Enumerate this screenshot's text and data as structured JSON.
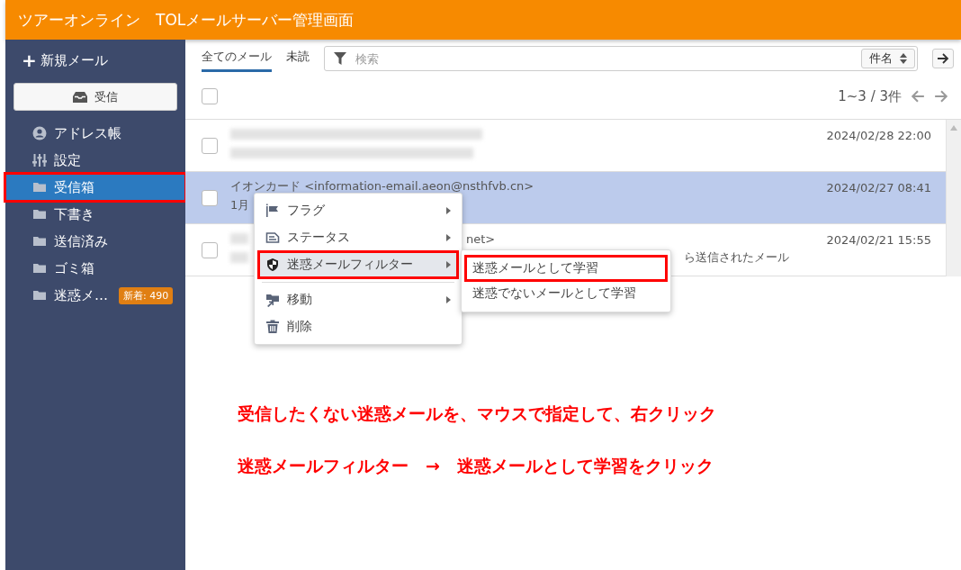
{
  "header": {
    "title": "ツアーオンライン　TOLメールサーバー管理画面"
  },
  "sidebar": {
    "compose": {
      "icon": "+",
      "label": "新規メール"
    },
    "receive_button": "受信",
    "items": [
      {
        "kind": "addressbook",
        "label": "アドレス帳",
        "selected": false,
        "highlighted": false
      },
      {
        "kind": "settings",
        "label": "設定",
        "selected": false,
        "highlighted": false
      },
      {
        "kind": "folder",
        "label": "受信箱",
        "selected": true,
        "highlighted": true
      },
      {
        "kind": "folder",
        "label": "下書き",
        "selected": false,
        "highlighted": false
      },
      {
        "kind": "folder",
        "label": "送信済み",
        "selected": false,
        "highlighted": false
      },
      {
        "kind": "folder",
        "label": "ゴミ箱",
        "selected": false,
        "highlighted": false
      },
      {
        "kind": "folder",
        "label": "迷惑メ…",
        "selected": false,
        "highlighted": false,
        "badge": "新着: 490"
      }
    ]
  },
  "filter_tabs": [
    {
      "label": "全てのメール",
      "selected": true
    },
    {
      "label": "未読",
      "selected": false
    }
  ],
  "search": {
    "placeholder": "検索",
    "sort": "件名"
  },
  "select_all": {
    "checked": false
  },
  "pagination": "1~3 / 3件",
  "messages": [
    {
      "blurred": true,
      "date": "2024/02/28 22:00",
      "selected": false,
      "checked": false
    },
    {
      "blurred": false,
      "sender": "イオンカード <information-email.aeon@nsthfvb.cn>",
      "subject": "1月",
      "date": "2024/02/27 08:41",
      "selected": true,
      "checked": false
    },
    {
      "blurred": true,
      "sender": "net>",
      "subject": "ら送信されたメール",
      "date": "2024/02/21 15:55",
      "selected": false,
      "checked": false
    }
  ],
  "context_menu": {
    "items": [
      {
        "kind": "flag",
        "label": "フラグ",
        "submenu": true,
        "highlighted": false
      },
      {
        "kind": "status",
        "label": "ステータス",
        "submenu": true,
        "highlighted": false
      },
      {
        "kind": "shield",
        "label": "迷惑メールフィルター",
        "submenu": true,
        "highlighted": true
      },
      {
        "kind": "move",
        "label": "移動",
        "submenu": true,
        "highlighted": false,
        "separator_before": true
      },
      {
        "kind": "trash",
        "label": "削除",
        "submenu": false,
        "highlighted": false
      }
    ],
    "submenu": [
      {
        "label": "迷惑メールとして学習",
        "highlighted": true
      },
      {
        "label": "迷惑でないメールとして学習",
        "highlighted": false
      }
    ]
  },
  "instructions": [
    "受信したくない迷惑メールを、マウスで指定して、右クリック",
    "迷惑メールフィルター　→　迷惑メールとして学習をクリック"
  ]
}
